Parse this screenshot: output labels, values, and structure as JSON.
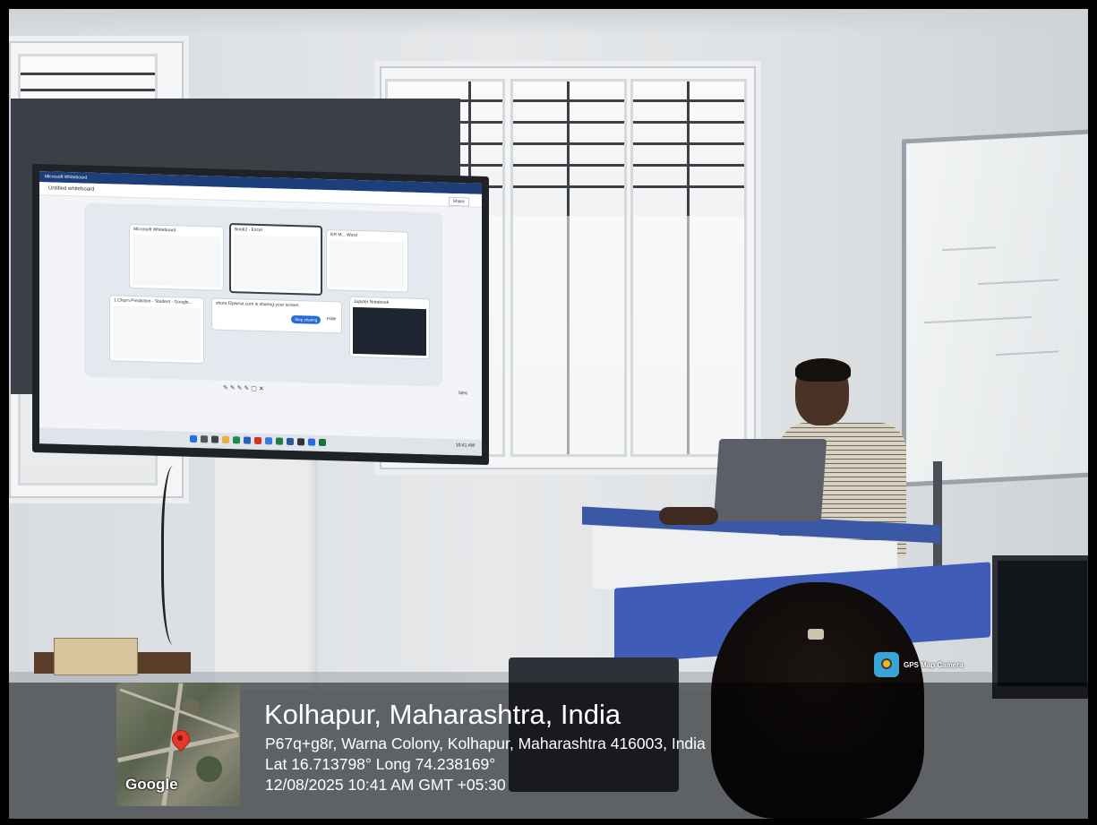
{
  "overlay": {
    "badge_label": "GPS Map Camera",
    "map_brand": "Google",
    "title": "Kolhapur, Maharashtra, India",
    "address": "P67q+g8r, Warna Colony, Kolhapur, Maharashtra 416003, India",
    "coordinates": "Lat 16.713798° Long 74.238169°",
    "datetime": "12/08/2025 10:41 AM GMT +05:30"
  },
  "screen": {
    "app_title": "Microsoft Whiteboard",
    "doc_title": "Untitled whiteboard",
    "share_label": "Share",
    "windows": [
      {
        "label": "Microsoft Whiteboard"
      },
      {
        "label": "Book2 - Excel"
      },
      {
        "label": "ER M... Word"
      },
      {
        "label": "1.Churn Prediction - Student - Google..."
      },
      {
        "label": "shore.f2pwrse.com is sharing your screen."
      },
      {
        "label": "Jupyter Notebook"
      }
    ],
    "stop_sharing_label": "Stop sharing",
    "hide_label": "Hide",
    "zoom_level": "56%",
    "clock": "10:41 AM"
  },
  "colors": {
    "desk_blue": "#3f5db8",
    "pin_red": "#e6352b",
    "wall": "#e6e8ea"
  }
}
